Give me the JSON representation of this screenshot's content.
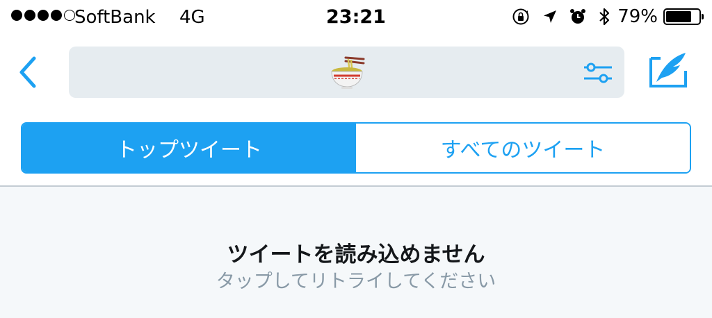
{
  "status_bar": {
    "signal_bars": 5,
    "signal_filled": 4,
    "carrier": "SoftBank",
    "network": "4G",
    "time": "23:21",
    "icons": [
      "orientation-lock-icon",
      "location-arrow-icon",
      "alarm-icon",
      "bluetooth-icon"
    ],
    "battery_percent": "79%",
    "battery_level": 0.79
  },
  "nav": {
    "back_icon": "chevron-left-icon",
    "search_query_emoji": "ramen-bowl-emoji",
    "filter_icon": "sliders-icon",
    "compose_icon": "compose-feather-icon"
  },
  "tabs": [
    {
      "label": "トップツイート",
      "active": true
    },
    {
      "label": "すべてのツイート",
      "active": false
    }
  ],
  "content": {
    "error_message": "ツイートを読み込めません",
    "retry_hint": "タップしてリトライしてください"
  },
  "colors": {
    "accent": "#1da1f2",
    "search_bg": "#e6ecf0",
    "content_bg": "#f5f8fa",
    "hint_text": "#8899a6"
  }
}
